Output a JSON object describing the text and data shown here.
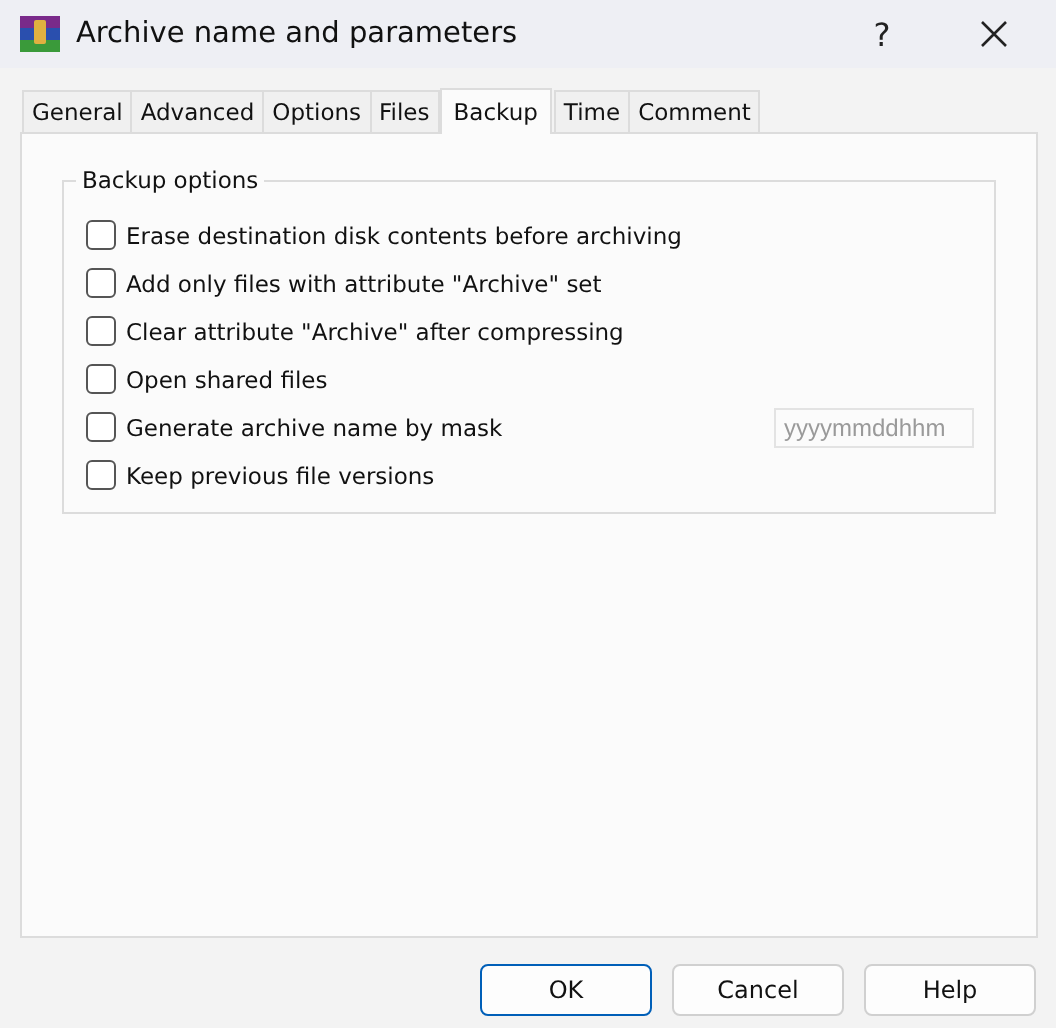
{
  "window": {
    "title": "Archive name and parameters",
    "help": "?"
  },
  "tabs": [
    {
      "label": "General",
      "selected": false
    },
    {
      "label": "Advanced",
      "selected": false
    },
    {
      "label": "Options",
      "selected": false
    },
    {
      "label": "Files",
      "selected": false
    },
    {
      "label": "Backup",
      "selected": true
    },
    {
      "label": "Time",
      "selected": false
    },
    {
      "label": "Comment",
      "selected": false
    }
  ],
  "group": {
    "title": "Backup options",
    "options": [
      {
        "label": "Erase destination disk contents before archiving",
        "checked": false
      },
      {
        "label": "Add only files with attribute \"Archive\" set",
        "checked": false
      },
      {
        "label": "Clear attribute \"Archive\" after compressing",
        "checked": false
      },
      {
        "label": "Open shared files",
        "checked": false
      },
      {
        "label": "Generate archive name by mask",
        "checked": false,
        "field": {
          "value": "yyyymmddhhm",
          "disabled": true
        }
      },
      {
        "label": "Keep previous file versions",
        "checked": false
      }
    ]
  },
  "buttons": [
    {
      "label": "OK",
      "selected": true
    },
    {
      "label": "Cancel",
      "selected": false
    },
    {
      "label": "Help",
      "selected": false
    }
  ]
}
